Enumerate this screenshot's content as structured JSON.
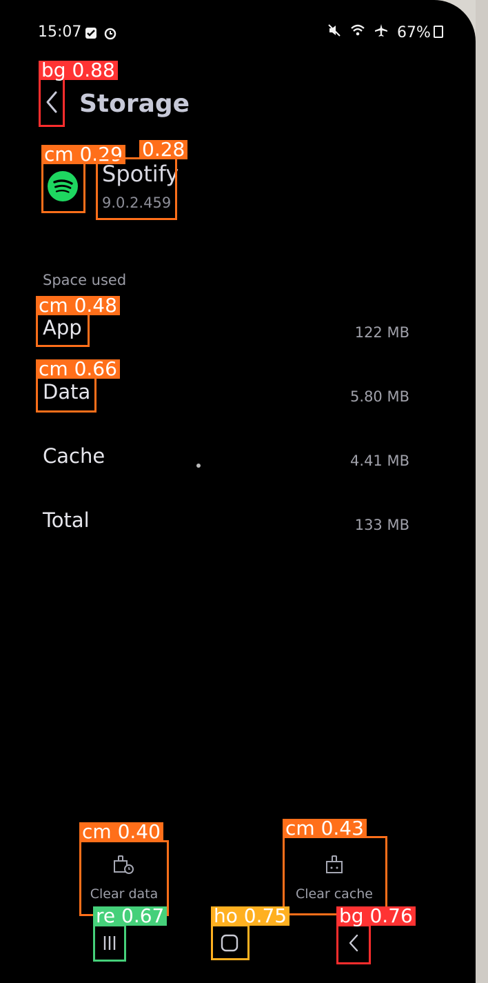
{
  "status_bar": {
    "time": "15:07",
    "battery": "67%",
    "icons": [
      "checkbox-icon",
      "alarm-icon",
      "mute-icon",
      "wifi-icon",
      "airplane-icon",
      "battery-icon"
    ]
  },
  "header": {
    "title": "Storage",
    "back_icon": "back-chevron-icon"
  },
  "app": {
    "name": "Spotify",
    "version": "9.0.2.459",
    "icon": "spotify-logo-icon"
  },
  "space_used": {
    "section_label": "Space used",
    "rows": [
      {
        "label": "App",
        "value": "122 MB"
      },
      {
        "label": "Data",
        "value": "5.80 MB"
      },
      {
        "label": "Cache",
        "value": "4.41 MB"
      },
      {
        "label": "Total",
        "value": "133 MB"
      }
    ]
  },
  "actions": {
    "clear_data": "Clear data",
    "clear_cache": "Clear cache"
  },
  "nav_bar": {
    "recents_icon": "recents-icon",
    "home_icon": "home-icon",
    "back_icon": "back-icon"
  },
  "detections": [
    {
      "label": "bg 0.88",
      "color": "#ff3333"
    },
    {
      "label": "cm 0.29",
      "color": "#ff6f1a"
    },
    {
      "label": "0.28",
      "color": "#ff6f1a"
    },
    {
      "label": "cm 0.48",
      "color": "#ff6f1a"
    },
    {
      "label": "cm 0.66",
      "color": "#ff6f1a"
    },
    {
      "label": "cm 0.40",
      "color": "#ff6f1a"
    },
    {
      "label": "cm 0.43",
      "color": "#ff6f1a"
    },
    {
      "label": "re 0.67",
      "color": "#45d07a"
    },
    {
      "label": "ho 0.75",
      "color": "#ffb020"
    },
    {
      "label": "bg 0.76",
      "color": "#ff3333"
    }
  ]
}
